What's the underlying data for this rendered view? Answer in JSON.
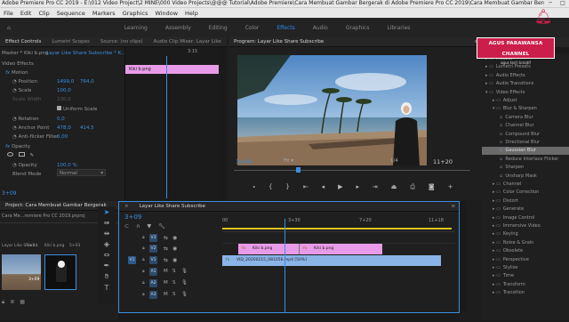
{
  "title_text": "Adobe Premiere Pro CC 2019 - E:\\012 Video Project\\2 MINE\\000 Video Projects\\@@@ Tutorial\\Adobe Premiere\\Cara Membuat Gambar Bergerak di Adobe Premiere Pro CC 2019\\Cara Membuat Gambar Bergerak di Adobe Premiere",
  "menu": [
    "File",
    "Edit",
    "Clip",
    "Sequence",
    "Markers",
    "Graphics",
    "Window",
    "Help"
  ],
  "workspaces": [
    "Learning",
    "Assembly",
    "Editing",
    "Color",
    "Effects",
    "Audio",
    "Graphics",
    "Libraries"
  ],
  "workspace_active": 4,
  "ec_tabs": [
    "Effect Controls",
    "Lumetri Scopes",
    "Source: (no clips)",
    "Audio Clip Mixer: Layar Like"
  ],
  "ec": {
    "master": "Master * Kiki b.png",
    "seq": "Layar Like Share Subscribe * K...",
    "timecode_top": "3:15",
    "clip_label": "Kiki b.png",
    "video_effects": "Video Effects",
    "motion": "Motion",
    "position": "Position",
    "pos_x": "1499,0",
    "pos_y": "764,0",
    "scale": "Scale",
    "scale_val": "100,0",
    "scale_width": "Scale Width",
    "scale_width_val": "100,0",
    "uniform": "Uniform Scale",
    "rotation": "Rotation",
    "rot_val": "0,0",
    "anchor": "Anchor Point",
    "anc_x": "478,0",
    "anc_y": "414,5",
    "antiflicker": "Anti-flicker Filter",
    "af_val": "0,00",
    "opacity_group": "Opacity",
    "opacity": "Opacity",
    "op_val": "100,0 %",
    "blend": "Blend Mode",
    "blend_val": "Normal",
    "timecode": "3+09"
  },
  "program": {
    "title": "Program: Layar Like Share Subscribe",
    "timecode_left": "3+09",
    "fit": "Fit",
    "fraction": "1/4",
    "timecode_right": "11+20",
    "menu_icon": "hamburger-icon"
  },
  "project": {
    "title": "Project: Cara Membuat Gambar Bergerak",
    "filename": "Cara Me...remiere Pro CC 2019.prproj",
    "item1": "Layar Like Share...",
    "item1_dur": "5+24",
    "item2": "Kiki b.png",
    "item2_dur": "5+03",
    "item3_dur": "3+09",
    "seq_label": "Layar Like Share Subscribe"
  },
  "timeline": {
    "tab": "Layar Like Share Subscribe",
    "timecode": "3+09",
    "ruler": [
      "00",
      "3+30",
      "7+20",
      "11+18"
    ],
    "tracks_video": [
      "V3",
      "V2",
      "V1"
    ],
    "tracks_audio": [
      "A1",
      "A2",
      "A3"
    ],
    "clip1": "Kiki b.png",
    "clip2": "Kiki b.png",
    "clip3": "VID_20200215_081056.mp4 [50%]"
  },
  "effects": {
    "search": "",
    "items": [
      {
        "label": "Presets",
        "indent": 0,
        "kind": "folder"
      },
      {
        "label": "Lumetri Presets",
        "indent": 0,
        "kind": "folder"
      },
      {
        "label": "Audio Effects",
        "indent": 0,
        "kind": "folder"
      },
      {
        "label": "Audio Transitions",
        "indent": 0,
        "kind": "folder"
      },
      {
        "label": "Video Effects",
        "indent": 0,
        "kind": "folder-open"
      },
      {
        "label": "Adjust",
        "indent": 1,
        "kind": "folder"
      },
      {
        "label": "Blur & Sharpen",
        "indent": 1,
        "kind": "folder-open"
      },
      {
        "label": "Camera Blur",
        "indent": 2,
        "kind": "fx"
      },
      {
        "label": "Channel Blur",
        "indent": 2,
        "kind": "fx"
      },
      {
        "label": "Compound Blur",
        "indent": 2,
        "kind": "fx"
      },
      {
        "label": "Directional Blur",
        "indent": 2,
        "kind": "fx"
      },
      {
        "label": "Gaussian Blur",
        "indent": 2,
        "kind": "fx",
        "selected": true
      },
      {
        "label": "Reduce Interlace Flicker",
        "indent": 2,
        "kind": "fx"
      },
      {
        "label": "Sharpen",
        "indent": 2,
        "kind": "fx"
      },
      {
        "label": "Unsharp Mask",
        "indent": 2,
        "kind": "fx"
      },
      {
        "label": "Channel",
        "indent": 1,
        "kind": "folder"
      },
      {
        "label": "Color Correction",
        "indent": 1,
        "kind": "folder"
      },
      {
        "label": "Distort",
        "indent": 1,
        "kind": "folder"
      },
      {
        "label": "Generate",
        "indent": 1,
        "kind": "folder"
      },
      {
        "label": "Image Control",
        "indent": 1,
        "kind": "folder"
      },
      {
        "label": "Immersive Video",
        "indent": 1,
        "kind": "folder"
      },
      {
        "label": "Keying",
        "indent": 1,
        "kind": "folder"
      },
      {
        "label": "Noise & Grain",
        "indent": 1,
        "kind": "folder"
      },
      {
        "label": "Obsolete",
        "indent": 1,
        "kind": "folder"
      },
      {
        "label": "Perspective",
        "indent": 1,
        "kind": "folder"
      },
      {
        "label": "Stylize",
        "indent": 1,
        "kind": "folder"
      },
      {
        "label": "Time",
        "indent": 1,
        "kind": "folder"
      },
      {
        "label": "Transform",
        "indent": 1,
        "kind": "folder"
      },
      {
        "label": "Transition",
        "indent": 1,
        "kind": "folder"
      }
    ]
  },
  "channel": {
    "name": "AGUS PARAWANSA CHANNEL",
    "watermark": "agus tech kreatif"
  },
  "colors": {
    "accent": "#2d8ceb",
    "clip_pink": "#e89be8",
    "clip_blue": "#8ab4e8",
    "playhead": "#3a8fe0",
    "brand": "#cc1e4a"
  }
}
